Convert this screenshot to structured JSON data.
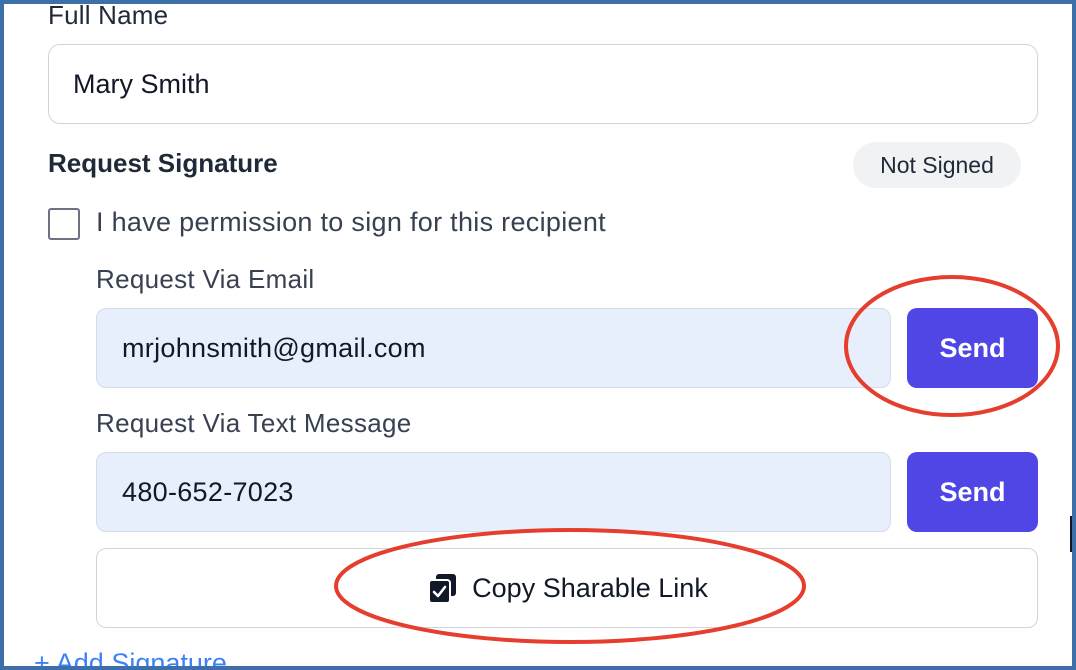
{
  "form": {
    "full_name_label": "Full Name",
    "full_name_value": "Mary Smith",
    "section_title": "Request Signature",
    "status_badge": "Not Signed",
    "permission_label": "I have permission to sign for this recipient",
    "permission_checked": false,
    "email": {
      "label": "Request Via Email",
      "value": "mrjohnsmith@gmail.com",
      "send_label": "Send"
    },
    "text_message": {
      "label": "Request Via Text Message",
      "value": "480-652-7023",
      "send_label": "Send"
    },
    "copy_link_label": "Copy Sharable Link",
    "copy_link_icon": "copy-check-icon",
    "add_signature_label": "+ Add Signature"
  },
  "colors": {
    "accent": "#4f46e5",
    "input_fill": "#e8effc",
    "frame": "#3d6fa8",
    "annotation": "#e53e2e",
    "link": "#3b82f6"
  }
}
